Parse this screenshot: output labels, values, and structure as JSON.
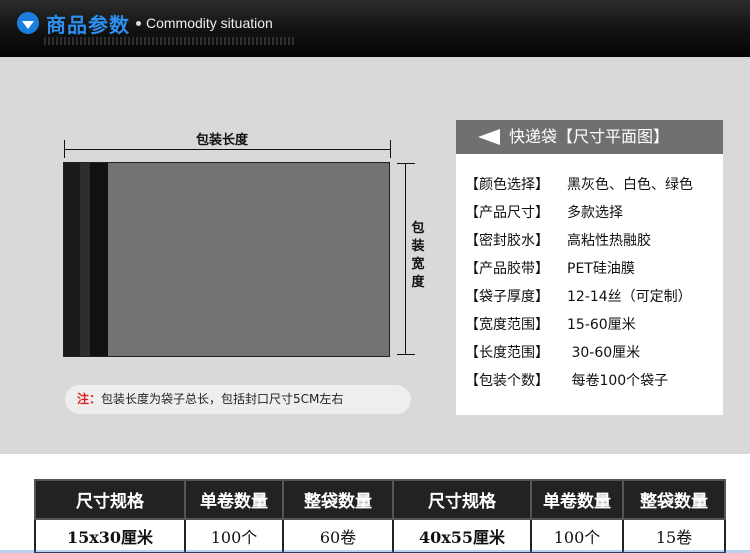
{
  "header": {
    "title_cn": "商品参数",
    "title_en": "Commodity situation"
  },
  "diagram": {
    "length_label": "包装长度",
    "width_label": [
      "包",
      "装",
      "宽",
      "度"
    ],
    "note_prefix": "注：",
    "note_text": "包装长度为袋子总长，包括封口尺寸5CM左右"
  },
  "spec": {
    "title": "快递袋【尺寸平面图】",
    "rows": [
      {
        "key": "【颜色选择】",
        "value": "黑灰色、白色、绿色"
      },
      {
        "key": "【产品尺寸】",
        "value": "多款选择"
      },
      {
        "key": "【密封胶水】",
        "value": "高粘性热融胶"
      },
      {
        "key": "【产品胶带】",
        "value": "PET硅油膜"
      },
      {
        "key": "【袋子厚度】",
        "value": "12-14丝（可定制）"
      },
      {
        "key": "【宽度范围】",
        "value": "15-60厘米"
      },
      {
        "key": "【长度范围】",
        "value": " 30-60厘米"
      },
      {
        "key": "【包装个数】",
        "value": " 每卷100个袋子"
      }
    ]
  },
  "table": {
    "headers": [
      "尺寸规格",
      "单卷数量",
      "整袋数量",
      "尺寸规格",
      "单卷数量",
      "整袋数量"
    ],
    "rows": [
      [
        "15x30厘米",
        "100个",
        "60卷",
        "40x55厘米",
        "100个",
        "15卷"
      ]
    ]
  },
  "colors": {
    "accent_blue": "#2e8ff0",
    "note_red": "#e02020"
  }
}
